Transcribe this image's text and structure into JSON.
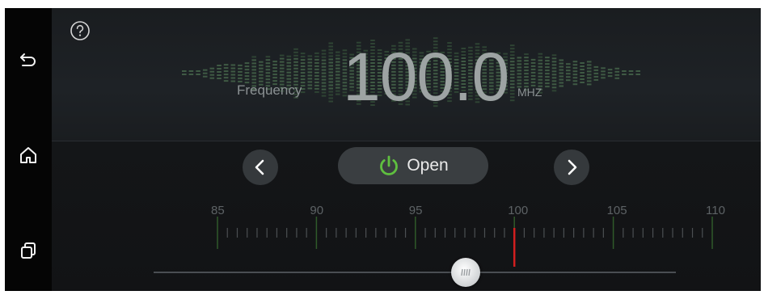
{
  "nav": {
    "icons": [
      "back-arrow-icon",
      "home-icon",
      "recent-apps-icon"
    ]
  },
  "radio": {
    "help_icon": "question-mark-icon",
    "frequency_label": "Frequency",
    "frequency_value": "100.0",
    "unit": "MHZ",
    "power_button_label": "Open",
    "power_icon_color": "#5fbf3f",
    "prev_icon": "chevron-left-icon",
    "next_icon": "chevron-right-icon",
    "scale_labels": [
      "85",
      "90",
      "95",
      "100",
      "105",
      "110"
    ],
    "current_frequency": 100.0,
    "scale_min": 85,
    "scale_max": 110,
    "needle_color": "#d21f1f"
  }
}
